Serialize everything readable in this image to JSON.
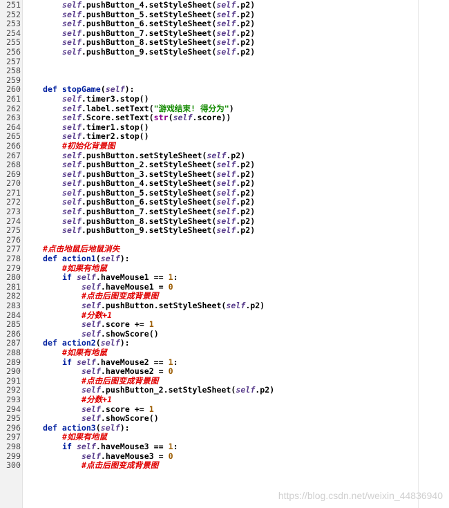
{
  "editor": {
    "lines": [
      {
        "n": "251",
        "indent": 8,
        "tokens": [
          {
            "t": "self",
            "c": "self"
          },
          {
            "t": ".pushButton_4.setStyleSheet(",
            "c": "op"
          },
          {
            "t": "self",
            "c": "self"
          },
          {
            "t": ".p2)",
            "c": "op"
          }
        ]
      },
      {
        "n": "252",
        "indent": 8,
        "tokens": [
          {
            "t": "self",
            "c": "self"
          },
          {
            "t": ".pushButton_5.setStyleSheet(",
            "c": "op"
          },
          {
            "t": "self",
            "c": "self"
          },
          {
            "t": ".p2)",
            "c": "op"
          }
        ]
      },
      {
        "n": "253",
        "indent": 8,
        "tokens": [
          {
            "t": "self",
            "c": "self"
          },
          {
            "t": ".pushButton_6.setStyleSheet(",
            "c": "op"
          },
          {
            "t": "self",
            "c": "self"
          },
          {
            "t": ".p2)",
            "c": "op"
          }
        ]
      },
      {
        "n": "254",
        "indent": 8,
        "tokens": [
          {
            "t": "self",
            "c": "self"
          },
          {
            "t": ".pushButton_7.setStyleSheet(",
            "c": "op"
          },
          {
            "t": "self",
            "c": "self"
          },
          {
            "t": ".p2)",
            "c": "op"
          }
        ]
      },
      {
        "n": "255",
        "indent": 8,
        "tokens": [
          {
            "t": "self",
            "c": "self"
          },
          {
            "t": ".pushButton_8.setStyleSheet(",
            "c": "op"
          },
          {
            "t": "self",
            "c": "self"
          },
          {
            "t": ".p2)",
            "c": "op"
          }
        ]
      },
      {
        "n": "256",
        "indent": 8,
        "tokens": [
          {
            "t": "self",
            "c": "self"
          },
          {
            "t": ".pushButton_9.setStyleSheet(",
            "c": "op"
          },
          {
            "t": "self",
            "c": "self"
          },
          {
            "t": ".p2)",
            "c": "op"
          }
        ]
      },
      {
        "n": "257",
        "indent": 0,
        "tokens": []
      },
      {
        "n": "258",
        "indent": 0,
        "tokens": []
      },
      {
        "n": "259",
        "indent": 0,
        "tokens": []
      },
      {
        "n": "260",
        "indent": 4,
        "tokens": [
          {
            "t": "def ",
            "c": "kw"
          },
          {
            "t": "stopGame",
            "c": "fn"
          },
          {
            "t": "(",
            "c": "op"
          },
          {
            "t": "self",
            "c": "self"
          },
          {
            "t": "):",
            "c": "op"
          }
        ]
      },
      {
        "n": "261",
        "indent": 8,
        "tokens": [
          {
            "t": "self",
            "c": "self"
          },
          {
            "t": ".timer3.stop()",
            "c": "op"
          }
        ]
      },
      {
        "n": "262",
        "indent": 8,
        "tokens": [
          {
            "t": "self",
            "c": "self"
          },
          {
            "t": ".label.setText(",
            "c": "op"
          },
          {
            "t": "\"游戏结束! 得分为\"",
            "c": "str"
          },
          {
            "t": ")",
            "c": "op"
          }
        ]
      },
      {
        "n": "263",
        "indent": 8,
        "tokens": [
          {
            "t": "self",
            "c": "self"
          },
          {
            "t": ".Score.setText(",
            "c": "op"
          },
          {
            "t": "str",
            "c": "bi"
          },
          {
            "t": "(",
            "c": "op"
          },
          {
            "t": "self",
            "c": "self"
          },
          {
            "t": ".score))",
            "c": "op"
          }
        ]
      },
      {
        "n": "264",
        "indent": 8,
        "tokens": [
          {
            "t": "self",
            "c": "self"
          },
          {
            "t": ".timer1.stop()",
            "c": "op"
          }
        ]
      },
      {
        "n": "265",
        "indent": 8,
        "tokens": [
          {
            "t": "self",
            "c": "self"
          },
          {
            "t": ".timer2.stop()",
            "c": "op"
          }
        ]
      },
      {
        "n": "266",
        "indent": 8,
        "tokens": [
          {
            "t": "#初始化背景图",
            "c": "cm"
          }
        ]
      },
      {
        "n": "267",
        "indent": 8,
        "tokens": [
          {
            "t": "self",
            "c": "self"
          },
          {
            "t": ".pushButton.setStyleSheet(",
            "c": "op"
          },
          {
            "t": "self",
            "c": "self"
          },
          {
            "t": ".p2)",
            "c": "op"
          }
        ]
      },
      {
        "n": "268",
        "indent": 8,
        "tokens": [
          {
            "t": "self",
            "c": "self"
          },
          {
            "t": ".pushButton_2.setStyleSheet(",
            "c": "op"
          },
          {
            "t": "self",
            "c": "self"
          },
          {
            "t": ".p2)",
            "c": "op"
          }
        ]
      },
      {
        "n": "269",
        "indent": 8,
        "tokens": [
          {
            "t": "self",
            "c": "self"
          },
          {
            "t": ".pushButton_3.setStyleSheet(",
            "c": "op"
          },
          {
            "t": "self",
            "c": "self"
          },
          {
            "t": ".p2)",
            "c": "op"
          }
        ]
      },
      {
        "n": "270",
        "indent": 8,
        "tokens": [
          {
            "t": "self",
            "c": "self"
          },
          {
            "t": ".pushButton_4.setStyleSheet(",
            "c": "op"
          },
          {
            "t": "self",
            "c": "self"
          },
          {
            "t": ".p2)",
            "c": "op"
          }
        ]
      },
      {
        "n": "271",
        "indent": 8,
        "tokens": [
          {
            "t": "self",
            "c": "self"
          },
          {
            "t": ".pushButton_5.setStyleSheet(",
            "c": "op"
          },
          {
            "t": "self",
            "c": "self"
          },
          {
            "t": ".p2)",
            "c": "op"
          }
        ]
      },
      {
        "n": "272",
        "indent": 8,
        "tokens": [
          {
            "t": "self",
            "c": "self"
          },
          {
            "t": ".pushButton_6.setStyleSheet(",
            "c": "op"
          },
          {
            "t": "self",
            "c": "self"
          },
          {
            "t": ".p2)",
            "c": "op"
          }
        ]
      },
      {
        "n": "273",
        "indent": 8,
        "tokens": [
          {
            "t": "self",
            "c": "self"
          },
          {
            "t": ".pushButton_7.setStyleSheet(",
            "c": "op"
          },
          {
            "t": "self",
            "c": "self"
          },
          {
            "t": ".p2)",
            "c": "op"
          }
        ]
      },
      {
        "n": "274",
        "indent": 8,
        "tokens": [
          {
            "t": "self",
            "c": "self"
          },
          {
            "t": ".pushButton_8.setStyleSheet(",
            "c": "op"
          },
          {
            "t": "self",
            "c": "self"
          },
          {
            "t": ".p2)",
            "c": "op"
          }
        ]
      },
      {
        "n": "275",
        "indent": 8,
        "tokens": [
          {
            "t": "self",
            "c": "self"
          },
          {
            "t": ".pushButton_9.setStyleSheet(",
            "c": "op"
          },
          {
            "t": "self",
            "c": "self"
          },
          {
            "t": ".p2)",
            "c": "op"
          }
        ]
      },
      {
        "n": "276",
        "indent": 0,
        "tokens": []
      },
      {
        "n": "277",
        "indent": 4,
        "tokens": [
          {
            "t": "#点击地鼠后地鼠消失",
            "c": "cm"
          }
        ]
      },
      {
        "n": "278",
        "indent": 4,
        "tokens": [
          {
            "t": "def ",
            "c": "kw"
          },
          {
            "t": "action1",
            "c": "fn"
          },
          {
            "t": "(",
            "c": "op"
          },
          {
            "t": "self",
            "c": "self"
          },
          {
            "t": "):",
            "c": "op"
          }
        ]
      },
      {
        "n": "279",
        "indent": 8,
        "tokens": [
          {
            "t": "#如果有地鼠",
            "c": "cm"
          }
        ]
      },
      {
        "n": "280",
        "indent": 8,
        "tokens": [
          {
            "t": "if ",
            "c": "kw"
          },
          {
            "t": "self",
            "c": "self"
          },
          {
            "t": ".haveMouse1 == ",
            "c": "op"
          },
          {
            "t": "1",
            "c": "num"
          },
          {
            "t": ":",
            "c": "op"
          }
        ]
      },
      {
        "n": "281",
        "indent": 12,
        "tokens": [
          {
            "t": "self",
            "c": "self"
          },
          {
            "t": ".haveMouse1 = ",
            "c": "op"
          },
          {
            "t": "0",
            "c": "num"
          }
        ]
      },
      {
        "n": "282",
        "indent": 12,
        "tokens": [
          {
            "t": "#点击后图变成背景图",
            "c": "cm"
          }
        ]
      },
      {
        "n": "283",
        "indent": 12,
        "tokens": [
          {
            "t": "self",
            "c": "self"
          },
          {
            "t": ".pushButton.setStyleSheet(",
            "c": "op"
          },
          {
            "t": "self",
            "c": "self"
          },
          {
            "t": ".p2)",
            "c": "op"
          }
        ]
      },
      {
        "n": "284",
        "indent": 12,
        "tokens": [
          {
            "t": "#分数+1",
            "c": "cm"
          }
        ]
      },
      {
        "n": "285",
        "indent": 12,
        "tokens": [
          {
            "t": "self",
            "c": "self"
          },
          {
            "t": ".score += ",
            "c": "op"
          },
          {
            "t": "1",
            "c": "num"
          }
        ]
      },
      {
        "n": "286",
        "indent": 12,
        "tokens": [
          {
            "t": "self",
            "c": "self"
          },
          {
            "t": ".showScore()",
            "c": "op"
          }
        ]
      },
      {
        "n": "287",
        "indent": 4,
        "tokens": [
          {
            "t": "def ",
            "c": "kw"
          },
          {
            "t": "action2",
            "c": "fn"
          },
          {
            "t": "(",
            "c": "op"
          },
          {
            "t": "self",
            "c": "self"
          },
          {
            "t": "):",
            "c": "op"
          }
        ]
      },
      {
        "n": "288",
        "indent": 8,
        "tokens": [
          {
            "t": "#如果有地鼠",
            "c": "cm"
          }
        ]
      },
      {
        "n": "289",
        "indent": 8,
        "tokens": [
          {
            "t": "if ",
            "c": "kw"
          },
          {
            "t": "self",
            "c": "self"
          },
          {
            "t": ".haveMouse2 == ",
            "c": "op"
          },
          {
            "t": "1",
            "c": "num"
          },
          {
            "t": ":",
            "c": "op"
          }
        ]
      },
      {
        "n": "290",
        "indent": 12,
        "tokens": [
          {
            "t": "self",
            "c": "self"
          },
          {
            "t": ".haveMouse2 = ",
            "c": "op"
          },
          {
            "t": "0",
            "c": "num"
          }
        ]
      },
      {
        "n": "291",
        "indent": 12,
        "tokens": [
          {
            "t": "#点击后图变成背景图",
            "c": "cm"
          }
        ]
      },
      {
        "n": "292",
        "indent": 12,
        "tokens": [
          {
            "t": "self",
            "c": "self"
          },
          {
            "t": ".pushButton_2.setStyleSheet(",
            "c": "op"
          },
          {
            "t": "self",
            "c": "self"
          },
          {
            "t": ".p2)",
            "c": "op"
          }
        ]
      },
      {
        "n": "293",
        "indent": 12,
        "tokens": [
          {
            "t": "#分数+1",
            "c": "cm"
          }
        ]
      },
      {
        "n": "294",
        "indent": 12,
        "tokens": [
          {
            "t": "self",
            "c": "self"
          },
          {
            "t": ".score += ",
            "c": "op"
          },
          {
            "t": "1",
            "c": "num"
          }
        ]
      },
      {
        "n": "295",
        "indent": 12,
        "tokens": [
          {
            "t": "self",
            "c": "self"
          },
          {
            "t": ".showScore()",
            "c": "op"
          }
        ]
      },
      {
        "n": "296",
        "indent": 4,
        "tokens": [
          {
            "t": "def ",
            "c": "kw"
          },
          {
            "t": "action3",
            "c": "fn"
          },
          {
            "t": "(",
            "c": "op"
          },
          {
            "t": "self",
            "c": "self"
          },
          {
            "t": "):",
            "c": "op"
          }
        ]
      },
      {
        "n": "297",
        "indent": 8,
        "tokens": [
          {
            "t": "#如果有地鼠",
            "c": "cm"
          }
        ]
      },
      {
        "n": "298",
        "indent": 8,
        "tokens": [
          {
            "t": "if ",
            "c": "kw"
          },
          {
            "t": "self",
            "c": "self"
          },
          {
            "t": ".haveMouse3 == ",
            "c": "op"
          },
          {
            "t": "1",
            "c": "num"
          },
          {
            "t": ":",
            "c": "op"
          }
        ]
      },
      {
        "n": "299",
        "indent": 12,
        "tokens": [
          {
            "t": "self",
            "c": "self"
          },
          {
            "t": ".haveMouse3 = ",
            "c": "op"
          },
          {
            "t": "0",
            "c": "num"
          }
        ]
      },
      {
        "n": "300",
        "indent": 12,
        "tokens": [
          {
            "t": "#点击后图变成背景图",
            "c": "cm"
          }
        ]
      }
    ]
  },
  "watermark": "https://blog.csdn.net/weixin_44836940"
}
